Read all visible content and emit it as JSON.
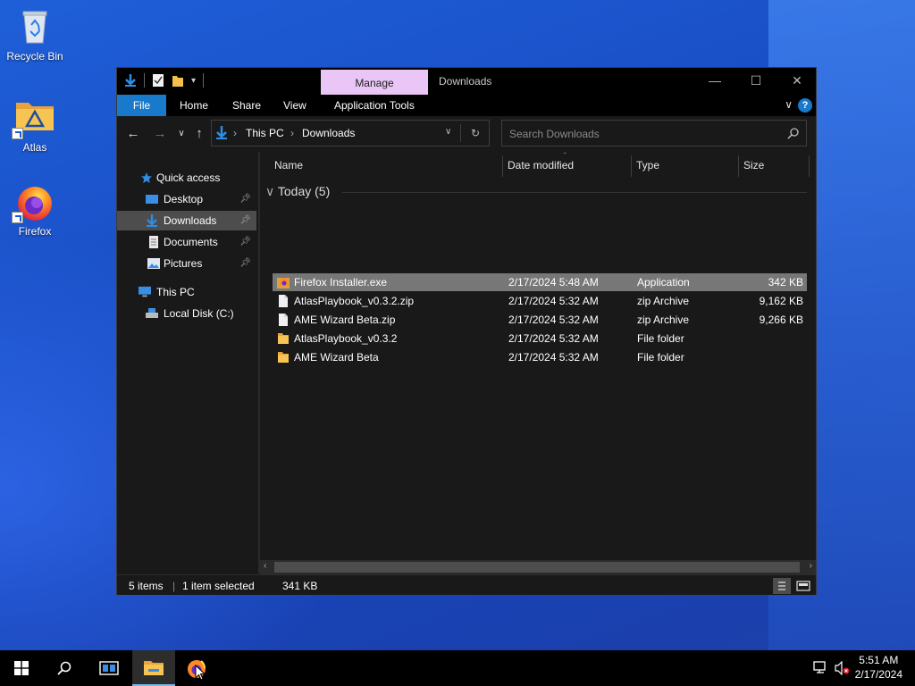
{
  "desktop": {
    "icons": [
      {
        "label": "Recycle Bin"
      },
      {
        "label": "Atlas"
      },
      {
        "label": "Firefox"
      }
    ]
  },
  "window": {
    "context_tab": "Manage",
    "title": "Downloads",
    "ribbon": {
      "tabs": [
        "File",
        "Home",
        "Share",
        "View",
        "Application Tools"
      ]
    },
    "address": {
      "parts": [
        "This PC",
        "Downloads"
      ]
    },
    "search": {
      "placeholder": "Search Downloads"
    },
    "nav": {
      "items": [
        {
          "label": "Quick access",
          "icon": "star-icon"
        },
        {
          "label": "Desktop",
          "icon": "desktop-icon",
          "pinned": true
        },
        {
          "label": "Downloads",
          "icon": "download-arrow-icon",
          "pinned": true,
          "selected": true
        },
        {
          "label": "Documents",
          "icon": "document-icon",
          "pinned": true
        },
        {
          "label": "Pictures",
          "icon": "pictures-icon",
          "pinned": true
        },
        {
          "label": "This PC",
          "icon": "computer-icon"
        },
        {
          "label": "Local Disk (C:)",
          "icon": "drive-icon"
        }
      ]
    },
    "columns": [
      "Name",
      "Date modified",
      "Type",
      "Size"
    ],
    "group": {
      "label": "Today (5)"
    },
    "files": [
      {
        "name": "Firefox Installer.exe",
        "date": "2/17/2024 5:48 AM",
        "type": "Application",
        "size": "342 KB",
        "icon": "firefox-installer-icon",
        "selected": true
      },
      {
        "name": "AtlasPlaybook_v0.3.2.zip",
        "date": "2/17/2024 5:32 AM",
        "type": "zip Archive",
        "size": "9,162 KB",
        "icon": "zip-file-icon"
      },
      {
        "name": "AME Wizard Beta.zip",
        "date": "2/17/2024 5:32 AM",
        "type": "zip Archive",
        "size": "9,266 KB",
        "icon": "zip-file-icon"
      },
      {
        "name": "AtlasPlaybook_v0.3.2",
        "date": "2/17/2024 5:32 AM",
        "type": "File folder",
        "size": "",
        "icon": "folder-icon"
      },
      {
        "name": "AME Wizard Beta",
        "date": "2/17/2024 5:32 AM",
        "type": "File folder",
        "size": "",
        "icon": "folder-icon"
      }
    ],
    "status": {
      "items": "5 items",
      "selection": "1 item selected",
      "size": "341 KB"
    }
  },
  "taskbar": {
    "time": "5:51 AM",
    "date": "2/17/2024"
  },
  "colors": {
    "accent": "#1979ca",
    "manage_tab": "#e9c6f5",
    "selection": "#777777"
  }
}
